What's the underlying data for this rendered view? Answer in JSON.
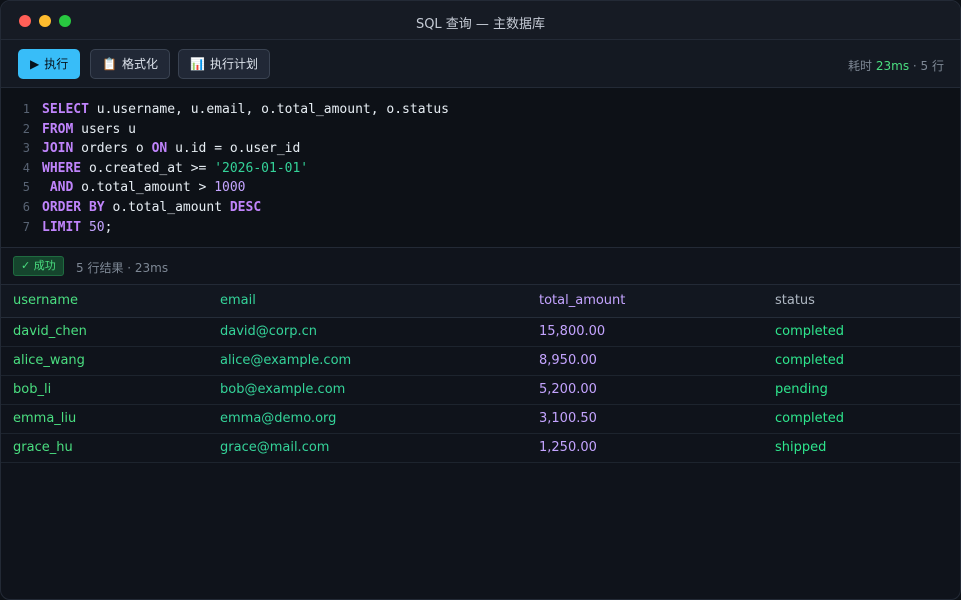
{
  "window": {
    "title": "SQL 查询 — 主数据库",
    "colors": {
      "close": "#ff5f57",
      "minimize": "#febc2e",
      "maximize": "#28c840"
    }
  },
  "toolbar": {
    "run_icon": "▶",
    "run_label": "执行",
    "format_icon": "📋",
    "format_label": "格式化",
    "plan_icon": "📊",
    "plan_label": "执行计划",
    "stats_prefix": "耗时 ",
    "stats_time": "23ms",
    "stats_suffix": " · 5 行"
  },
  "editor": {
    "lines": [
      {
        "n": "1",
        "tokens": [
          {
            "t": "kw",
            "v": "SELECT"
          },
          {
            "t": "id",
            "v": " u.username, u.email, o.total_amount, o.status"
          }
        ]
      },
      {
        "n": "2",
        "tokens": [
          {
            "t": "kw",
            "v": "FROM"
          },
          {
            "t": "id",
            "v": " users u"
          }
        ]
      },
      {
        "n": "3",
        "tokens": [
          {
            "t": "kw",
            "v": "JOIN"
          },
          {
            "t": "id",
            "v": " orders o "
          },
          {
            "t": "kw",
            "v": "ON"
          },
          {
            "t": "id",
            "v": " u.id = o.user_id"
          }
        ]
      },
      {
        "n": "4",
        "tokens": [
          {
            "t": "kw",
            "v": "WHERE"
          },
          {
            "t": "id",
            "v": " o.created_at >= "
          },
          {
            "t": "str",
            "v": "'2026-01-01'"
          }
        ]
      },
      {
        "n": "5",
        "tokens": [
          {
            "t": "id",
            "v": " "
          },
          {
            "t": "kw",
            "v": "AND"
          },
          {
            "t": "id",
            "v": " o.total_amount > "
          },
          {
            "t": "num",
            "v": "1000"
          }
        ]
      },
      {
        "n": "6",
        "tokens": [
          {
            "t": "kw",
            "v": "ORDER BY"
          },
          {
            "t": "id",
            "v": " o.total_amount "
          },
          {
            "t": "kw",
            "v": "DESC"
          }
        ]
      },
      {
        "n": "7",
        "tokens": [
          {
            "t": "kw",
            "v": "LIMIT"
          },
          {
            "t": "id",
            "v": " "
          },
          {
            "t": "num",
            "v": "50"
          },
          {
            "t": "id",
            "v": ";"
          }
        ]
      }
    ]
  },
  "result": {
    "badge": "✓ 成功",
    "summary": "5 行结果 · 23ms"
  },
  "table": {
    "columns": [
      "username",
      "email",
      "total_amount",
      "status"
    ],
    "rows": [
      [
        "david_chen",
        "david@corp.cn",
        "15,800.00",
        "completed"
      ],
      [
        "alice_wang",
        "alice@example.com",
        "8,950.00",
        "completed"
      ],
      [
        "bob_li",
        "bob@example.com",
        "5,200.00",
        "pending"
      ],
      [
        "emma_liu",
        "emma@demo.org",
        "3,100.50",
        "completed"
      ],
      [
        "grace_hu",
        "grace@mail.com",
        "1,250.00",
        "shipped"
      ]
    ]
  }
}
